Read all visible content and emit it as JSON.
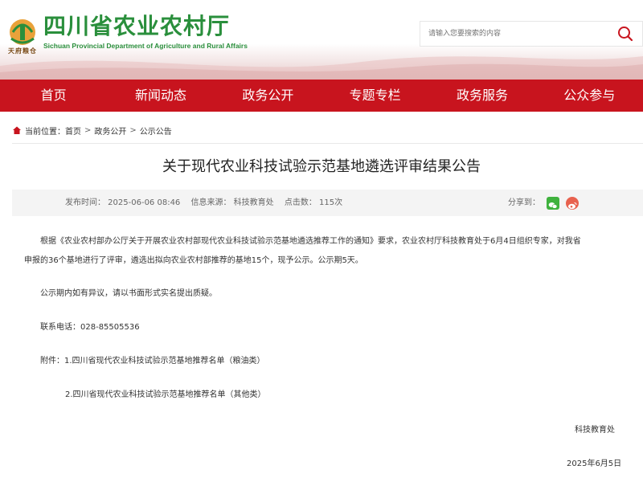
{
  "header": {
    "site_name_cn": "四川省农业农村厅",
    "site_name_en": "Sichuan Provincial Department of Agriculture and Rural Affairs",
    "seal_text": "天府粮仓",
    "search_placeholder": "请输入您要搜索的内容"
  },
  "nav": {
    "items": [
      "首页",
      "新闻动态",
      "政务公开",
      "专题专栏",
      "政务服务",
      "公众参与"
    ]
  },
  "breadcrumb": {
    "label": "当前位置：",
    "items": [
      "首页",
      "政务公开",
      "公示公告"
    ],
    "sep": ">"
  },
  "article": {
    "title": "关于现代农业科技试验示范基地遴选评审结果公告",
    "meta": {
      "publish_time": "发布时间：  2025-06-06 08:46",
      "source": "信息来源：  科技教育处",
      "clicks": "点击数：  115次"
    },
    "share_label": "分享到：",
    "body": {
      "p1_line1": "根据《农业农村部办公厅关于开展农业农村部现代农业科技试验示范基地遴选推荐工作的通知》要求，农业农村厅科技教育处于6月4日组织专家，对我省",
      "p1_line2": "申报的36个基地进行了评审，遴选出拟向农业农村部推荐的基地15个，现予公示。公示期5天。",
      "p2": "公示期内如有异议，请以书面形式实名提出质疑。",
      "phone": "联系电话：028-85505536",
      "attach1": "附件：1.四川省现代农业科技试验示范基地推荐名单（粮油类）",
      "attach2": "2.四川省现代农业科技试验示范基地推荐名单（其他类）",
      "signature": "科技教育处",
      "date": "2025年6月5日"
    }
  },
  "colors": {
    "nav_bg": "#c8141e",
    "logo_green": "#2a8f3c",
    "search_icon": "#c8141e"
  }
}
